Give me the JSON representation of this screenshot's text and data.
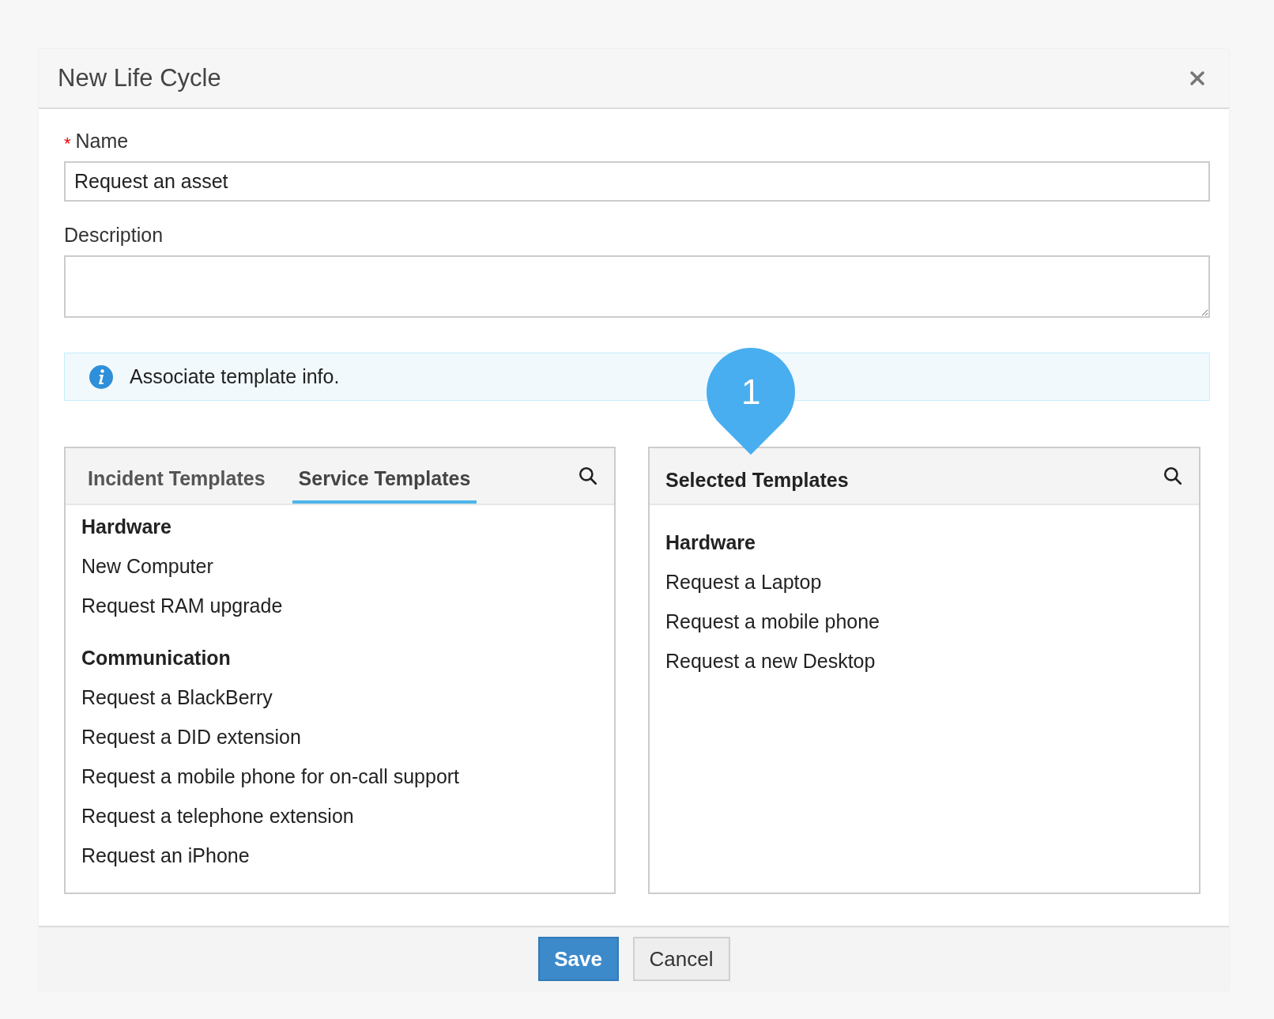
{
  "dialog": {
    "title": "New Life Cycle"
  },
  "name_field": {
    "label": "Name",
    "required": true,
    "required_mark": "*",
    "value": "Request an asset"
  },
  "description_field": {
    "label": "Description"
  },
  "info": {
    "text": "Associate template info."
  },
  "callout": {
    "text": "1"
  },
  "left_panel": {
    "tabs": [
      {
        "label": "Incident Templates",
        "selected": false
      },
      {
        "label": "Service Templates",
        "selected": true
      }
    ],
    "groups": [
      {
        "title": "Hardware",
        "items": [
          "New Computer",
          "Request RAM upgrade"
        ]
      },
      {
        "title": "Communication",
        "items": [
          "Request a BlackBerry",
          "Request a DID extension",
          "Request a mobile phone for on-call support",
          "Request a telephone extension",
          "Request an iPhone"
        ]
      }
    ]
  },
  "right_panel": {
    "title": "Selected Templates",
    "groups": [
      {
        "title": "Hardware",
        "items": [
          "Request a Laptop",
          "Request a mobile phone",
          "Request a new Desktop"
        ]
      }
    ]
  },
  "buttons": [
    {
      "label": "Save",
      "kind": "primary"
    },
    {
      "label": "Cancel",
      "kind": "secondary"
    }
  ]
}
